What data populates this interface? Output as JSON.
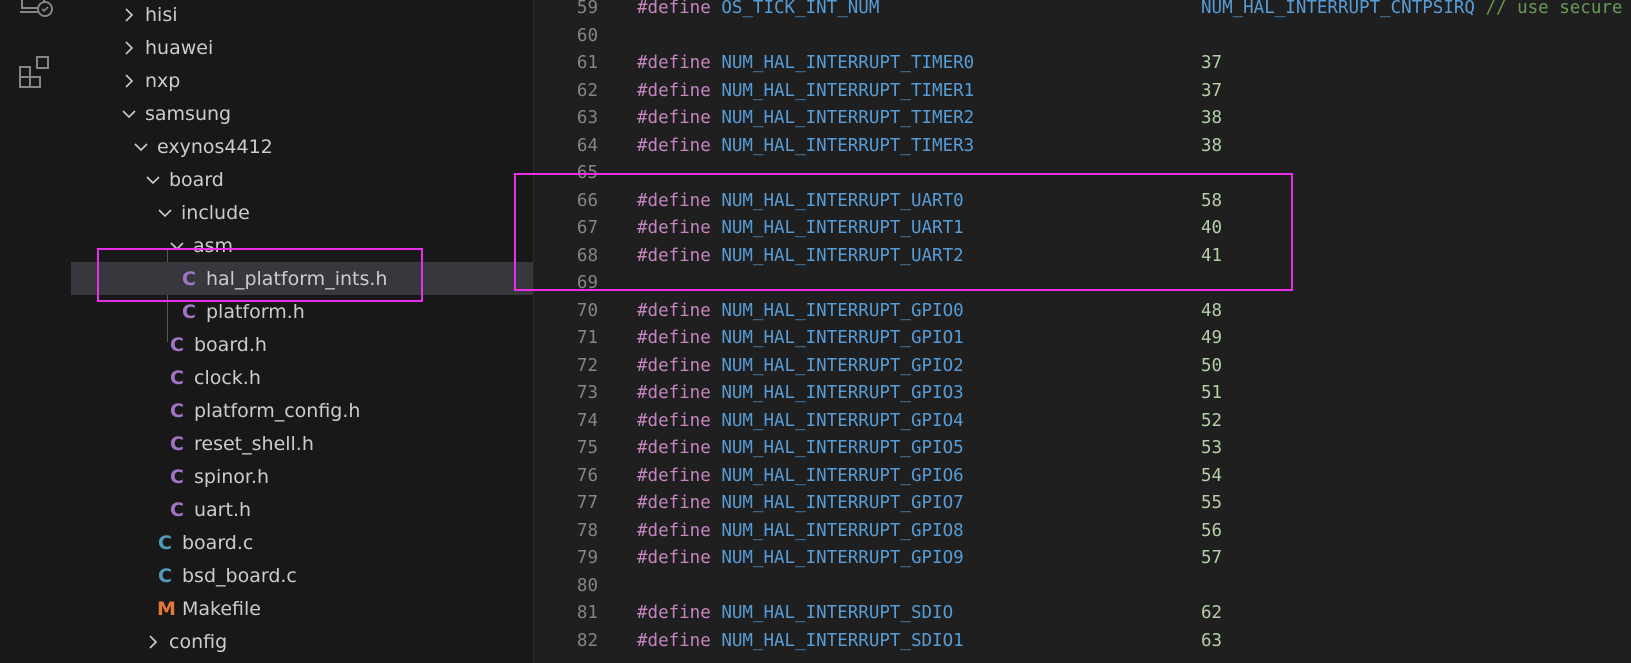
{
  "activity_bar": {
    "icons": [
      "remote-explorer-icon",
      "extensions-icon"
    ]
  },
  "explorer": {
    "rows": [
      {
        "label": "hisi",
        "kind": "folder",
        "expanded": false
      },
      {
        "label": "huawei",
        "kind": "folder",
        "expanded": false
      },
      {
        "label": "nxp",
        "kind": "folder",
        "expanded": false
      },
      {
        "label": "samsung",
        "kind": "folder",
        "expanded": true
      },
      {
        "label": "exynos4412",
        "kind": "folder",
        "expanded": true
      },
      {
        "label": "board",
        "kind": "folder",
        "expanded": true
      },
      {
        "label": "include",
        "kind": "folder",
        "expanded": true
      },
      {
        "label": "asm",
        "kind": "folder",
        "expanded": true
      },
      {
        "label": "hal_platform_ints.h",
        "kind": "c-header",
        "icon_letter": "C",
        "selected": true
      },
      {
        "label": "platform.h",
        "kind": "c-header",
        "icon_letter": "C"
      },
      {
        "label": "board.h",
        "kind": "c-header",
        "icon_letter": "C"
      },
      {
        "label": "clock.h",
        "kind": "c-header",
        "icon_letter": "C"
      },
      {
        "label": "platform_config.h",
        "kind": "c-header",
        "icon_letter": "C"
      },
      {
        "label": "reset_shell.h",
        "kind": "c-header",
        "icon_letter": "C"
      },
      {
        "label": "spinor.h",
        "kind": "c-header",
        "icon_letter": "C"
      },
      {
        "label": "uart.h",
        "kind": "c-header",
        "icon_letter": "C"
      },
      {
        "label": "board.c",
        "kind": "c-source",
        "icon_letter": "C"
      },
      {
        "label": "bsd_board.c",
        "kind": "c-source",
        "icon_letter": "C"
      },
      {
        "label": "Makefile",
        "kind": "makefile",
        "icon_letter": "M"
      },
      {
        "label": "config",
        "kind": "folder",
        "expanded": false
      }
    ]
  },
  "editor": {
    "lines": [
      {
        "n": "59",
        "kw": "#define",
        "name": "OS_TICK_INT_NUM",
        "value": "NUM_HAL_INTERRUPT_CNTPSIRQ",
        "comment": "// use secure physi"
      },
      {
        "n": "60"
      },
      {
        "n": "61",
        "kw": "#define",
        "name": "NUM_HAL_INTERRUPT_TIMER0",
        "value": "37"
      },
      {
        "n": "62",
        "kw": "#define",
        "name": "NUM_HAL_INTERRUPT_TIMER1",
        "value": "37"
      },
      {
        "n": "63",
        "kw": "#define",
        "name": "NUM_HAL_INTERRUPT_TIMER2",
        "value": "38"
      },
      {
        "n": "64",
        "kw": "#define",
        "name": "NUM_HAL_INTERRUPT_TIMER3",
        "value": "38"
      },
      {
        "n": "65"
      },
      {
        "n": "66",
        "kw": "#define",
        "name": "NUM_HAL_INTERRUPT_UART0",
        "value": "58"
      },
      {
        "n": "67",
        "kw": "#define",
        "name": "NUM_HAL_INTERRUPT_UART1",
        "value": "40"
      },
      {
        "n": "68",
        "kw": "#define",
        "name": "NUM_HAL_INTERRUPT_UART2",
        "value": "41"
      },
      {
        "n": "69"
      },
      {
        "n": "70",
        "kw": "#define",
        "name": "NUM_HAL_INTERRUPT_GPIO0",
        "value": "48"
      },
      {
        "n": "71",
        "kw": "#define",
        "name": "NUM_HAL_INTERRUPT_GPIO1",
        "value": "49"
      },
      {
        "n": "72",
        "kw": "#define",
        "name": "NUM_HAL_INTERRUPT_GPIO2",
        "value": "50"
      },
      {
        "n": "73",
        "kw": "#define",
        "name": "NUM_HAL_INTERRUPT_GPIO3",
        "value": "51"
      },
      {
        "n": "74",
        "kw": "#define",
        "name": "NUM_HAL_INTERRUPT_GPIO4",
        "value": "52"
      },
      {
        "n": "75",
        "kw": "#define",
        "name": "NUM_HAL_INTERRUPT_GPIO5",
        "value": "53"
      },
      {
        "n": "76",
        "kw": "#define",
        "name": "NUM_HAL_INTERRUPT_GPIO6",
        "value": "54"
      },
      {
        "n": "77",
        "kw": "#define",
        "name": "NUM_HAL_INTERRUPT_GPIO7",
        "value": "55"
      },
      {
        "n": "78",
        "kw": "#define",
        "name": "NUM_HAL_INTERRUPT_GPIO8",
        "value": "56"
      },
      {
        "n": "79",
        "kw": "#define",
        "name": "NUM_HAL_INTERRUPT_GPIO9",
        "value": "57"
      },
      {
        "n": "80"
      },
      {
        "n": "81",
        "kw": "#define",
        "name": "NUM_HAL_INTERRUPT_SDIO",
        "value": "62"
      },
      {
        "n": "82",
        "kw": "#define",
        "name": "NUM_HAL_INTERRUPT_SDIO1",
        "value": "63"
      }
    ]
  },
  "colors": {
    "highlight_box": "#e82ee8",
    "keyword": "#c586c0",
    "macro": "#569cd6",
    "number": "#b5cea8",
    "comment": "#6a9955",
    "header_icon": "#a074c4",
    "source_icon": "#519aba",
    "makefile_icon": "#e37933"
  }
}
